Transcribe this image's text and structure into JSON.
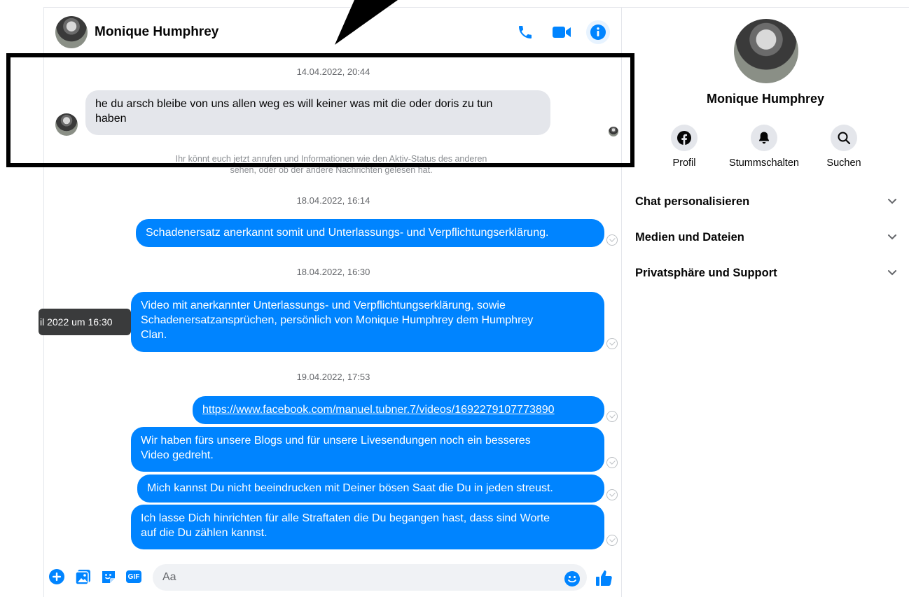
{
  "contact": {
    "name": "Monique Humphrey"
  },
  "header": {
    "icons": [
      "phone-icon",
      "video-camera-icon",
      "info-icon"
    ]
  },
  "messages": {
    "ts1": "14.04.2022, 20:44",
    "in1_line1": "he du arsch bleibe von uns allen weg es will keiner was mit die oder doris zu tun",
    "in1_line2": "haben",
    "notice_line1": "Ihr könnt euch jetzt anrufen und Informationen wie den Aktiv-Status des anderen",
    "notice_line2": "sehen, oder ob der andere Nachrichten gelesen hat.",
    "ts2": "18.04.2022, 16:14",
    "out1": "Schadenersatz anerkannt somit und Unterlassungs- und Verpflichtungserklärung.",
    "ts3": "18.04.2022, 16:30",
    "out2_line1": "Video mit anerkannter Unterlassungs- und Verpflichtungserklärung, sowie",
    "out2_line2": "Schadenersatzansprüchen,  persönlich von Monique Humphrey dem Humphrey",
    "out2_line3": "Clan.",
    "tooltip": "il 2022 um 16:30",
    "ts4": "19.04.2022, 17:53",
    "out3_link": "https://www.facebook.com/manuel.tubner.7/videos/1692279107773890",
    "out4_line1": "Wir haben fürs unsere Blogs und für unsere Livesendungen noch ein besseres",
    "out4_line2": "Video gedreht.",
    "out5": "Mich kannst Du nicht beeindrucken mit Deiner bösen Saat die Du in jeden streust.",
    "out6_line1": "Ich lasse Dich hinrichten für alle Straftaten die Du begangen hast, dass sind Worte",
    "out6_line2": "auf die Du zählen kannst."
  },
  "composer": {
    "placeholder": "Aa",
    "gif_label": "GIF"
  },
  "sidebar": {
    "actions": [
      {
        "label": "Profil",
        "icon": "facebook-icon"
      },
      {
        "label": "Stummschalten",
        "icon": "bell-icon"
      },
      {
        "label": "Suchen",
        "icon": "search-icon"
      }
    ],
    "sections": [
      {
        "label": "Chat personalisieren"
      },
      {
        "label": "Medien und Dateien"
      },
      {
        "label": "Privatsphäre und Support"
      }
    ]
  },
  "colors": {
    "accent": "#0084ff",
    "incoming_bubble": "#e4e6eb",
    "highlight_border": "#000000"
  }
}
